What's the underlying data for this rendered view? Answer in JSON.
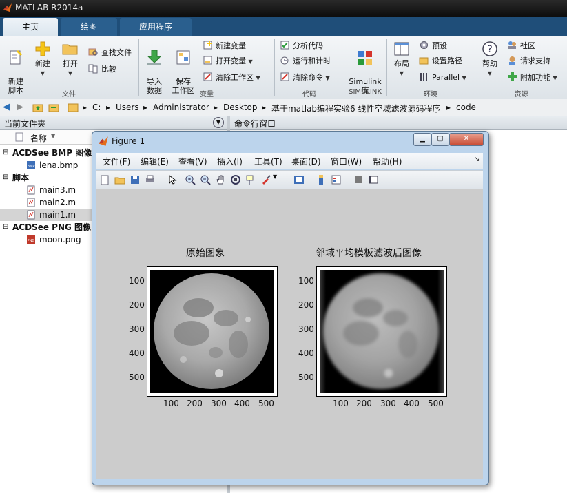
{
  "app": {
    "title": "MATLAB R2014a"
  },
  "tabs": [
    "主页",
    "绘图",
    "应用程序"
  ],
  "ribbon": {
    "file": {
      "new_script": "新建\n脚本",
      "new": "新建",
      "open": "打开",
      "find_files": "查找文件",
      "compare": "比较",
      "group": "文件"
    },
    "variable": {
      "import": "导入\n数据",
      "save_workspace": "保存\n工作区",
      "new_variable": "新建变量",
      "open_variable": "打开变量",
      "clear_workspace": "清除工作区",
      "group": "变量"
    },
    "code": {
      "analyze": "分析代码",
      "run_time": "运行和计时",
      "clear_commands": "清除命令",
      "group": "代码"
    },
    "simulink": {
      "label": "Simulink\n库",
      "group": "SIMULINK"
    },
    "env": {
      "layout": "布局",
      "preferences": "预设",
      "set_path": "设置路径",
      "parallel": "Parallel",
      "group": "环境"
    },
    "resources": {
      "help": "帮助",
      "community": "社区",
      "request_support": "请求支持",
      "addons": "附加功能",
      "group": "资源"
    }
  },
  "path": [
    "C:",
    "Users",
    "Administrator",
    "Desktop",
    "基于matlab编程实验6  线性空域滤波源码程序",
    "code"
  ],
  "left_panel": {
    "title": "当前文件夹",
    "column": "名称",
    "groups": [
      {
        "name": "ACDSee BMP 图像",
        "files": [
          {
            "name": "lena.bmp",
            "icon": "bmp-icon"
          }
        ]
      },
      {
        "name": "脚本",
        "files": [
          {
            "name": "main3.m",
            "icon": "m-file-icon"
          },
          {
            "name": "main2.m",
            "icon": "m-file-icon"
          },
          {
            "name": "main1.m",
            "icon": "m-file-icon",
            "selected": true
          }
        ]
      },
      {
        "name": "ACDSee PNG 图像",
        "files": [
          {
            "name": "moon.png",
            "icon": "png-icon"
          }
        ]
      }
    ]
  },
  "command_window": {
    "title": "命令行窗口"
  },
  "figure": {
    "title": "Figure 1",
    "menu": [
      "文件(F)",
      "编辑(E)",
      "查看(V)",
      "插入(I)",
      "工具(T)",
      "桌面(D)",
      "窗口(W)",
      "帮助(H)"
    ],
    "axes": [
      {
        "title": "原始图象"
      },
      {
        "title": "邻域平均模板滤波后图像"
      }
    ],
    "ticks": [
      "100",
      "200",
      "300",
      "400",
      "500"
    ]
  }
}
